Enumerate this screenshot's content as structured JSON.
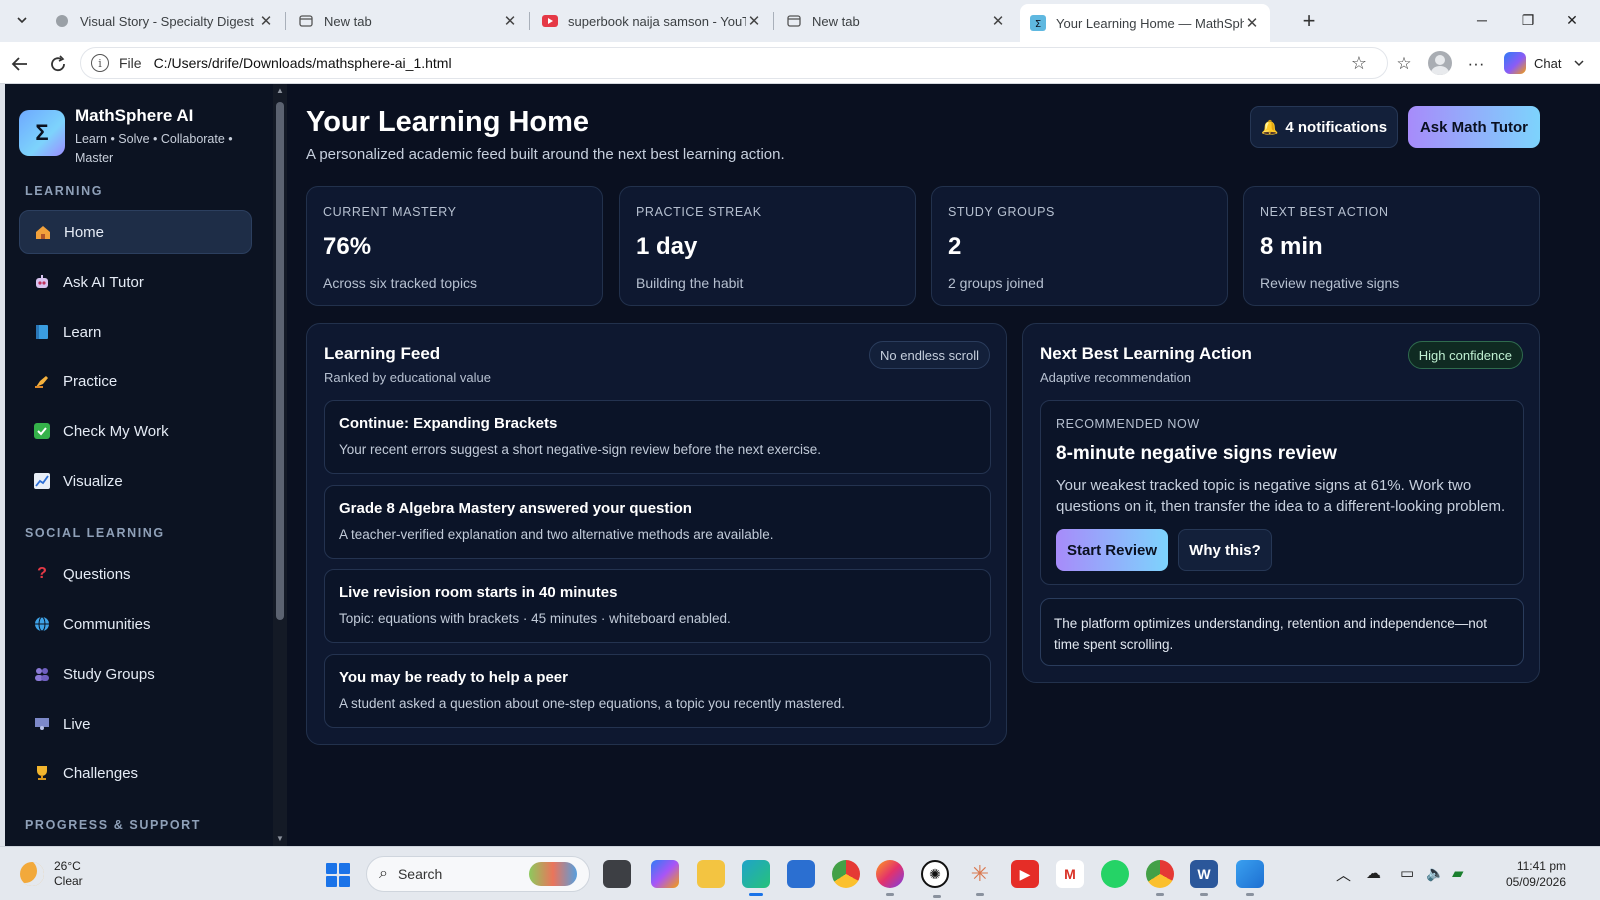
{
  "browser": {
    "tabs": [
      {
        "title": "Visual Story - Specialty Digest",
        "icon": "page-icon"
      },
      {
        "title": "New tab",
        "icon": "newtab-icon"
      },
      {
        "title": "superbook naija samson - YouTube",
        "icon": "youtube-icon"
      },
      {
        "title": "New tab",
        "icon": "newtab-icon"
      },
      {
        "title": "Your Learning Home — MathSphere AI",
        "icon": "mathsphere-icon",
        "active": true
      }
    ],
    "address": {
      "scheme": "File",
      "url": "C:/Users/drife/Downloads/mathsphere-ai_1.html"
    },
    "chat_label": "Chat"
  },
  "sidebar": {
    "brand_name": "MathSphere AI",
    "brand_logo": "Σ",
    "brand_tagline": "Learn • Solve • Collaborate • Master",
    "sections": {
      "learning": "LEARNING",
      "social": "SOCIAL LEARNING",
      "progress": "PROGRESS & SUPPORT"
    },
    "learning_items": [
      {
        "label": "Home",
        "icon": "house-icon"
      },
      {
        "label": "Ask AI Tutor",
        "icon": "robot-icon"
      },
      {
        "label": "Learn",
        "icon": "book-icon"
      },
      {
        "label": "Practice",
        "icon": "writing-hand-icon"
      },
      {
        "label": "Check My Work",
        "icon": "check-icon"
      },
      {
        "label": "Visualize",
        "icon": "chart-icon"
      }
    ],
    "social_items": [
      {
        "label": "Questions",
        "icon": "question-icon"
      },
      {
        "label": "Communities",
        "icon": "globe-icon"
      },
      {
        "label": "Study Groups",
        "icon": "people-icon"
      },
      {
        "label": "Live",
        "icon": "presenter-icon"
      },
      {
        "label": "Challenges",
        "icon": "trophy-icon"
      }
    ]
  },
  "header": {
    "title": "Your Learning Home",
    "subtitle": "A personalized academic feed built around the next best learning action.",
    "notifications": "4 notifications",
    "ask_tutor": "Ask Math Tutor"
  },
  "stats": [
    {
      "label": "CURRENT MASTERY",
      "value": "76%",
      "note": "Across six tracked topics"
    },
    {
      "label": "PRACTICE STREAK",
      "value": "1 day",
      "note": "Building the habit"
    },
    {
      "label": "STUDY GROUPS",
      "value": "2",
      "note": "2 groups joined"
    },
    {
      "label": "NEXT BEST ACTION",
      "value": "8 min",
      "note": "Review negative signs"
    }
  ],
  "feed": {
    "title": "Learning Feed",
    "subtitle": "Ranked by educational value",
    "badge": "No endless scroll",
    "items": [
      {
        "title": "Continue: Expanding Brackets",
        "desc": "Your recent errors suggest a short negative-sign review before the next exercise."
      },
      {
        "title": "Grade 8 Algebra Mastery answered your question",
        "desc": "A teacher-verified explanation and two alternative methods are available."
      },
      {
        "title": "Live revision room starts in 40 minutes",
        "desc": "Topic: equations with brackets · 45 minutes · whiteboard enabled."
      },
      {
        "title": "You may be ready to help a peer",
        "desc": "A student asked a question about one-step equations, a topic you recently mastered."
      }
    ]
  },
  "next_action": {
    "title": "Next Best Learning Action",
    "subtitle": "Adaptive recommendation",
    "badge": "High confidence",
    "rec_label": "RECOMMENDED NOW",
    "rec_title": "8-minute negative signs review",
    "rec_desc": "Your weakest tracked topic is negative signs at 61%. Work two questions on it, then transfer the idea to a different-looking problem.",
    "start": "Start Review",
    "why": "Why this?",
    "note": "The platform optimizes understanding, retention and independence—not time spent scrolling."
  },
  "taskbar": {
    "temp": "26°C",
    "condition": "Clear",
    "search": "Search",
    "time": "11:41 pm",
    "date": "05/09/2026"
  }
}
